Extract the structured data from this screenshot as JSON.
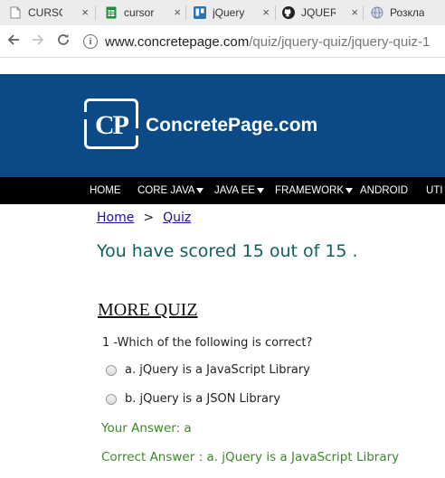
{
  "browser": {
    "tabs": [
      {
        "title": "CURSO",
        "icon": "document-icon"
      },
      {
        "title": "cursor",
        "icon": "sheets-icon"
      },
      {
        "title": "jQuery",
        "icon": "trello-icon"
      },
      {
        "title": "JQUER",
        "icon": "github-icon"
      },
      {
        "title": "Розкла",
        "icon": "globe-icon"
      }
    ],
    "close_glyph": "×",
    "url_host": "www.concretepage.com",
    "url_path": "/quiz/jquery-quiz/jquery-quiz-1",
    "info_glyph": "i"
  },
  "site": {
    "logo_letters": "CP",
    "name": "ConcretePage.com",
    "nav": [
      "HOME",
      "CORE JAVA",
      "JAVA EE",
      "FRAMEWORK",
      "ANDROID",
      "UTI"
    ]
  },
  "content": {
    "breadcrumb": {
      "home": "Home",
      "separator": ">",
      "quiz": "Quiz"
    },
    "score_text": "You have scored 15 out of 15 .",
    "more_quiz": "MORE QUIZ",
    "question": "1 -Which of the following is correct?",
    "options": [
      "a. jQuery is a JavaScript Library",
      "b. jQuery is a JSON Library"
    ],
    "your_answer": "Your Answer: a",
    "correct_answer": "Correct Answer : a. jQuery is a JavaScript Library"
  },
  "colors": {
    "header_bg": "#0b4a86",
    "nav_bg": "#000000",
    "score_text": "#11605f",
    "answer_text": "#3a8a24",
    "link": "#1a0dab"
  }
}
